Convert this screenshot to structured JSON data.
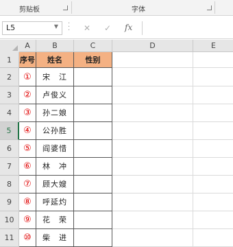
{
  "ribbon": {
    "group_clipboard": "剪贴板",
    "group_font": "字体"
  },
  "formula_bar": {
    "name_box": "L5",
    "fx_label": "fx",
    "cancel_icon": "✕",
    "enter_icon": "✓",
    "formula": ""
  },
  "columns": [
    "A",
    "B",
    "C",
    "D",
    "E"
  ],
  "rows": [
    "1",
    "2",
    "3",
    "4",
    "5",
    "6",
    "7",
    "8",
    "9",
    "10",
    "11"
  ],
  "selected_row": "5",
  "table": {
    "headers": [
      "序号",
      "姓名",
      "性别"
    ],
    "data": [
      {
        "no": "①",
        "name": "宋　江"
      },
      {
        "no": "②",
        "name": "卢俊义"
      },
      {
        "no": "③",
        "name": "孙二娘"
      },
      {
        "no": "④",
        "name": "公孙胜"
      },
      {
        "no": "⑤",
        "name": "阎婆惜"
      },
      {
        "no": "⑥",
        "name": "林　冲"
      },
      {
        "no": "⑦",
        "name": "顾大嫂"
      },
      {
        "no": "⑧",
        "name": "呼延灼"
      },
      {
        "no": "⑨",
        "name": "花　荣"
      },
      {
        "no": "⑩",
        "name": "柴　进"
      }
    ]
  },
  "colors": {
    "header_fill": "#f4b183",
    "number_red": "#e00000",
    "excel_green": "#217346"
  }
}
